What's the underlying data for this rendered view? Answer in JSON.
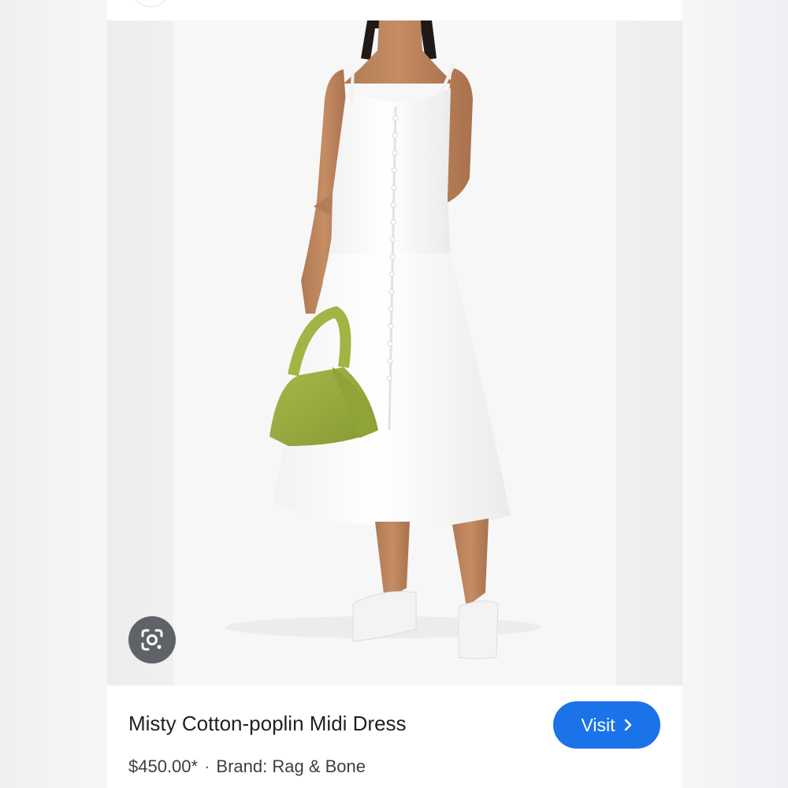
{
  "product": {
    "title": "Misty Cotton-poplin Midi Dress",
    "price": "$450.00*",
    "separator": "·",
    "brand": "Brand: Rag & Bone"
  },
  "actions": {
    "visit_label": "Visit",
    "visit_icon": "chevron-right-icon",
    "lens_icon": "google-lens-icon"
  },
  "colors": {
    "visit_button": "#1a73e8",
    "lens_button": "#5f6368",
    "dress": "#ffffff",
    "bag": "#9aaf3e"
  }
}
